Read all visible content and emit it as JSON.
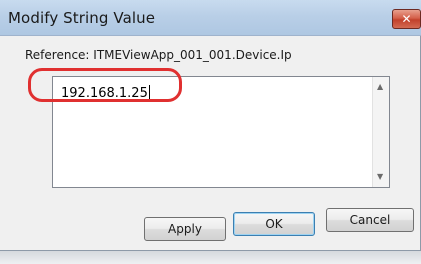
{
  "window": {
    "title": "Modify String Value",
    "close_icon_glyph": "✕"
  },
  "reference": {
    "label": "Reference: ITMEViewApp_001_001.Device.Ip"
  },
  "input": {
    "value": "192.168.1.25",
    "scroll_up_glyph": "▲",
    "scroll_down_glyph": "▼"
  },
  "buttons": {
    "apply": "Apply",
    "ok": "OK",
    "cancel": "Cancel"
  },
  "colors": {
    "highlight": "#e03030",
    "titlebar": "#b9cfe7",
    "close_button": "#c2412b"
  }
}
